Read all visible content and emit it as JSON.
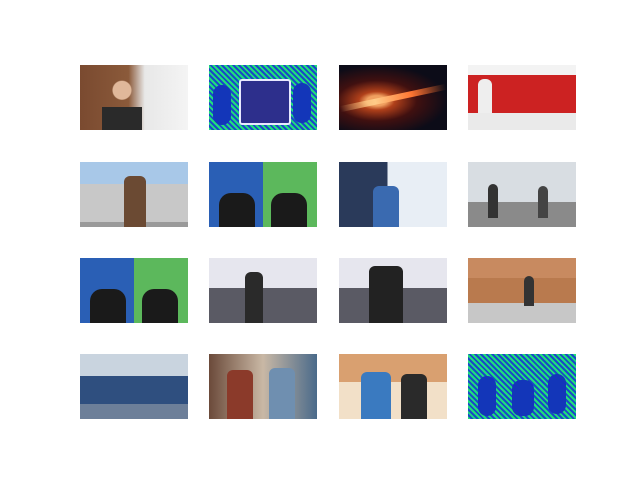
{
  "grid": {
    "tiles": [
      {
        "caption": ""
      },
      {
        "caption": ""
      },
      {
        "caption": ""
      },
      {
        "caption": ""
      },
      {
        "caption": ""
      },
      {
        "caption": ""
      },
      {
        "caption": ""
      },
      {
        "caption": ""
      },
      {
        "caption": ""
      },
      {
        "caption": ""
      },
      {
        "caption": ""
      },
      {
        "caption": ""
      },
      {
        "caption": ""
      },
      {
        "caption": ""
      },
      {
        "caption": ""
      },
      {
        "caption": ""
      }
    ]
  },
  "colors": {
    "pattern_green": "#1fe07a",
    "pattern_blue": "#1a48c8",
    "bus_red": "#c22222"
  }
}
